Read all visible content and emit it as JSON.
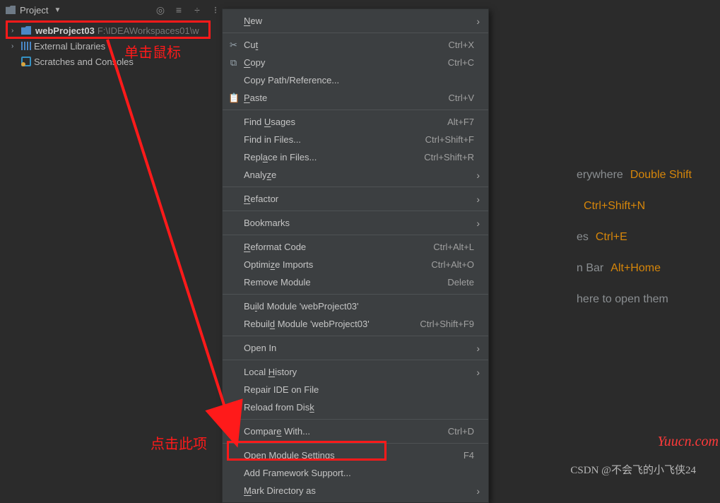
{
  "panel": {
    "title": "Project",
    "headerIcons": [
      "target-icon",
      "filter-icon",
      "collapse-icon",
      "settings-icon"
    ]
  },
  "tree": {
    "project": {
      "name": "webProject03",
      "path": "F:\\IDEAWorkspaces01\\w"
    },
    "ext": "External Libraries",
    "scratch": "Scratches and Consoles"
  },
  "annotations": {
    "click": "单击鼠标",
    "hint": "点击此项"
  },
  "menu": {
    "groups": [
      [
        {
          "icon": "",
          "html": "<u>N</u>ew",
          "shortcut": "",
          "sub": true
        }
      ],
      [
        {
          "icon": "✂",
          "html": "Cu<u>t</u>",
          "shortcut": "Ctrl+X"
        },
        {
          "icon": "⧉",
          "html": "<u>C</u>opy",
          "shortcut": "Ctrl+C"
        },
        {
          "icon": "",
          "html": "Copy Path/Reference...",
          "shortcut": ""
        },
        {
          "icon": "📋",
          "html": "<u>P</u>aste",
          "shortcut": "Ctrl+V"
        }
      ],
      [
        {
          "icon": "",
          "html": "Find <u>U</u>sages",
          "shortcut": "Alt+F7"
        },
        {
          "icon": "",
          "html": "Find in Files...",
          "shortcut": "Ctrl+Shift+F"
        },
        {
          "icon": "",
          "html": "Repl<u>a</u>ce in Files...",
          "shortcut": "Ctrl+Shift+R"
        },
        {
          "icon": "",
          "html": "Analy<u>z</u>e",
          "shortcut": "",
          "sub": true
        }
      ],
      [
        {
          "icon": "",
          "html": "<u>R</u>efactor",
          "shortcut": "",
          "sub": true
        }
      ],
      [
        {
          "icon": "",
          "html": "Bookmarks",
          "shortcut": "",
          "sub": true
        }
      ],
      [
        {
          "icon": "",
          "html": "<u>R</u>eformat Code",
          "shortcut": "Ctrl+Alt+L"
        },
        {
          "icon": "",
          "html": "Optimi<u>z</u>e Imports",
          "shortcut": "Ctrl+Alt+O"
        },
        {
          "icon": "",
          "html": "Remove Module",
          "shortcut": "Delete"
        }
      ],
      [
        {
          "icon": "",
          "html": "Bu<u>i</u>ld Module 'webProject03'",
          "shortcut": ""
        },
        {
          "icon": "",
          "html": "Rebuil<u>d</u> Module 'webProject03'",
          "shortcut": "Ctrl+Shift+F9"
        }
      ],
      [
        {
          "icon": "",
          "html": "Open In",
          "shortcut": "",
          "sub": true
        }
      ],
      [
        {
          "icon": "",
          "html": "Local <u>H</u>istory",
          "shortcut": "",
          "sub": true
        },
        {
          "icon": "",
          "html": "Repair IDE on File",
          "shortcut": ""
        },
        {
          "icon": "↻",
          "html": "Reload from Dis<u>k</u>",
          "shortcut": ""
        }
      ],
      [
        {
          "icon": "⎌",
          "html": "Compar<u>e</u> With...",
          "shortcut": "Ctrl+D"
        }
      ],
      [
        {
          "icon": "",
          "html": "Open Module <u>S</u>ettings",
          "shortcut": "F4"
        },
        {
          "icon": "",
          "html": "Add Framework Support...",
          "shortcut": ""
        },
        {
          "icon": "",
          "html": "<u>M</u>ark Directory as",
          "shortcut": "",
          "sub": true
        }
      ]
    ]
  },
  "welcome": {
    "lines": [
      {
        "t": "erywhere",
        "k": "Double Shift"
      },
      {
        "t": "",
        "k": "Ctrl+Shift+N"
      },
      {
        "t": "es",
        "k": "Ctrl+E"
      },
      {
        "t": "n Bar",
        "k": "Alt+Home"
      },
      {
        "t": "here to open them",
        "k": ""
      }
    ]
  },
  "watermark": {
    "csdn": "CSDN @不会飞的小飞侠24",
    "site": "Yuucn.com"
  }
}
